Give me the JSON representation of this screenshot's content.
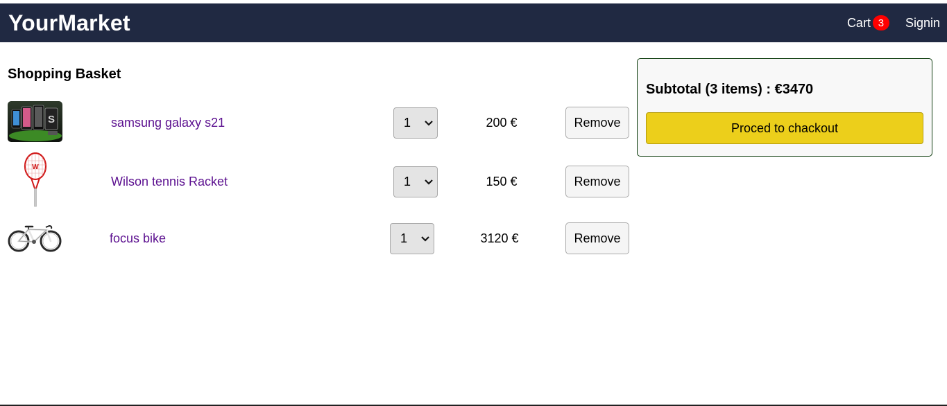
{
  "header": {
    "brand": "YourMarket",
    "cart_label": "Cart",
    "cart_count": "3",
    "signin_label": "Signin",
    "background_color": "#202942",
    "badge_color": "#ff0000"
  },
  "basket": {
    "title": "Shopping Basket",
    "items": [
      {
        "name": "samsung galaxy s21",
        "image": "samsung-galaxy-s21-image",
        "quantity": "1",
        "price": "200 €",
        "remove_label": "Remove"
      },
      {
        "name": "Wilson tennis Racket",
        "image": "tennis-racket-image",
        "quantity": "1",
        "price": "150 €",
        "remove_label": "Remove"
      },
      {
        "name": "focus bike",
        "image": "road-bike-image",
        "quantity": "1",
        "price": "3120 €",
        "remove_label": "Remove"
      }
    ]
  },
  "summary": {
    "subtotal_text": "Subtotal (3 items) : €3470",
    "checkout_label": "Proced to chackout",
    "checkout_color": "#eccf1b"
  }
}
